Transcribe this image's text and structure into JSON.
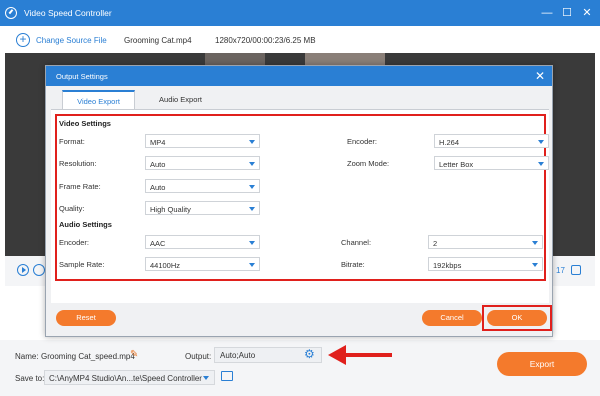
{
  "app": {
    "title": "Video Speed Controller",
    "minimize_icon": "minimize-icon",
    "maximize_icon": "maximize-icon",
    "close_icon": "close-icon"
  },
  "toolbar": {
    "change_source_label": "Change Source File",
    "file_name": "Grooming Cat.mp4",
    "file_info": "1280x720/00:00:23/6.25 MB"
  },
  "player": {
    "time_tail": "17"
  },
  "dialog": {
    "title": "Output Settings",
    "tabs": [
      {
        "label": "Video Export",
        "active": true
      },
      {
        "label": "Audio Export",
        "active": false
      }
    ],
    "video_settings": {
      "heading": "Video Settings",
      "format": {
        "label": "Format:",
        "value": "MP4"
      },
      "encoder": {
        "label": "Encoder:",
        "value": "H.264"
      },
      "resolution": {
        "label": "Resolution:",
        "value": "Auto"
      },
      "zoom_mode": {
        "label": "Zoom Mode:",
        "value": "Letter Box"
      },
      "frame_rate": {
        "label": "Frame Rate:",
        "value": "Auto"
      },
      "quality": {
        "label": "Quality:",
        "value": "High Quality"
      }
    },
    "audio_settings": {
      "heading": "Audio Settings",
      "encoder": {
        "label": "Encoder:",
        "value": "AAC"
      },
      "channel": {
        "label": "Channel:",
        "value": "2"
      },
      "sample_rate": {
        "label": "Sample Rate:",
        "value": "44100Hz"
      },
      "bitrate": {
        "label": "Bitrate:",
        "value": "192kbps"
      }
    },
    "buttons": {
      "reset": "Reset",
      "cancel": "Cancel",
      "ok": "OK"
    }
  },
  "bottom": {
    "name_label": "Name:",
    "output_name": "Grooming Cat_speed.mp4",
    "output_label": "Output:",
    "output_value": "Auto;Auto",
    "save_to_label": "Save to:",
    "save_path": "C:\\AnyMP4 Studio\\An...te\\Speed Controller",
    "export_label": "Export"
  },
  "colors": {
    "accent": "#2a7fd4",
    "orange": "#f47a2c",
    "highlight_red": "#e0201c"
  }
}
